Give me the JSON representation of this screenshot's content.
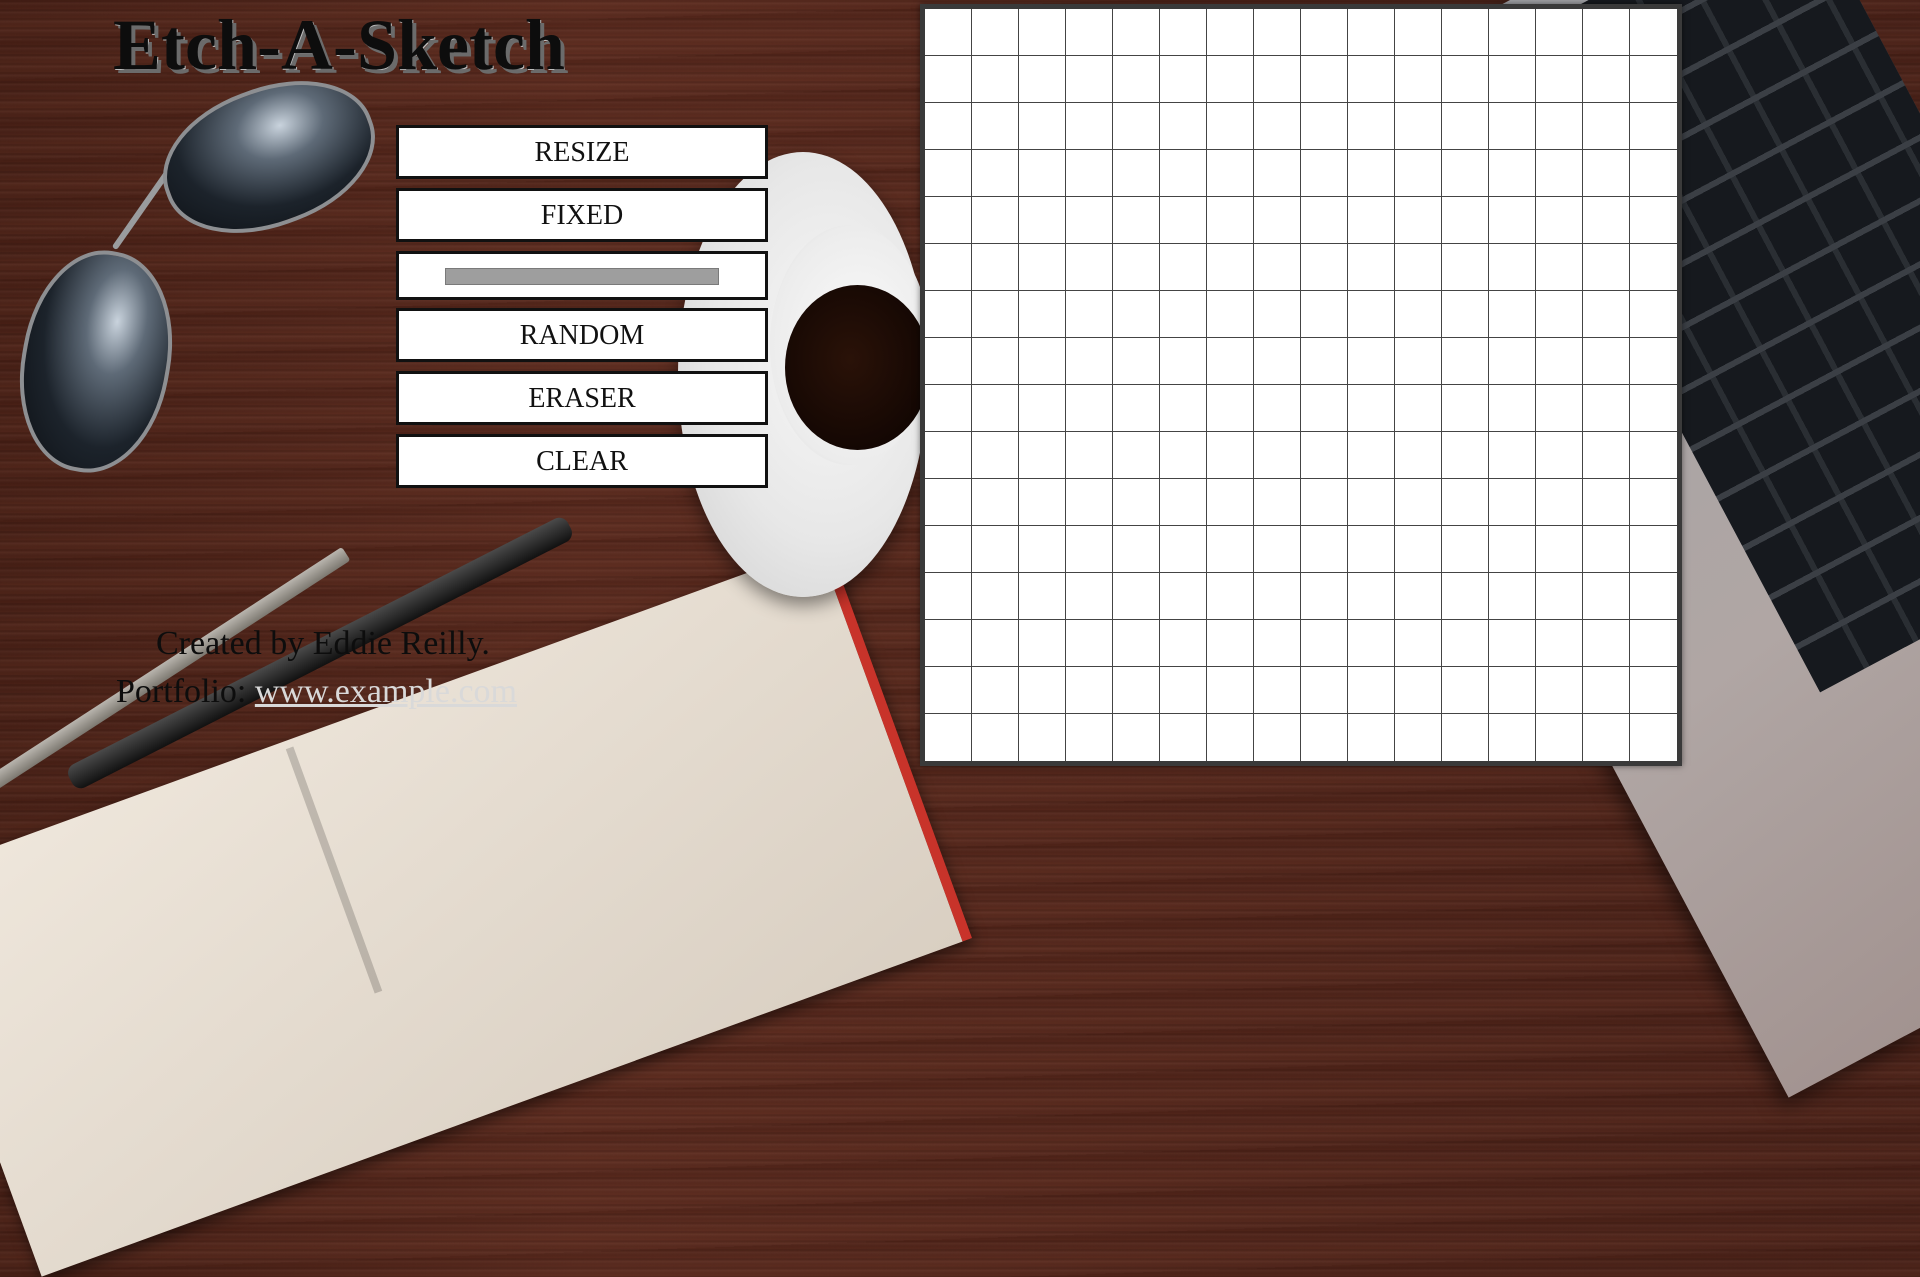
{
  "app": {
    "title": "Etch-A-Sketch"
  },
  "controls": {
    "resize_label": "RESIZE",
    "fixed_label": "FIXED",
    "random_label": "RANDOM",
    "eraser_label": "ERASER",
    "clear_label": "CLEAR"
  },
  "credits": {
    "created_by": "Created by Eddie Reilly.",
    "portfolio_label": "Portfolio:",
    "portfolio_link": "www.example.com"
  },
  "grid": {
    "size": 16,
    "cell_color": "#ffffff",
    "line_color": "#444444"
  },
  "colors": {
    "border": "#3a3a3a",
    "button_bg": "#ffffff",
    "button_text": "#111111",
    "slider": "#9e9e9e"
  }
}
